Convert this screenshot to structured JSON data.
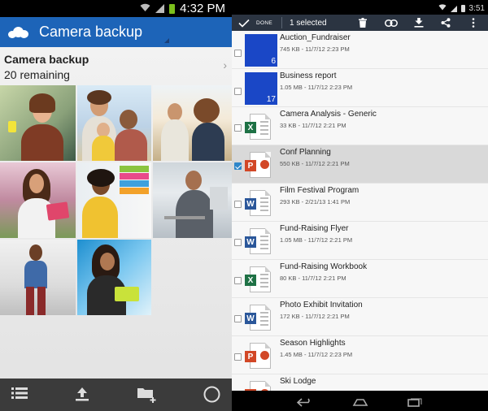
{
  "left": {
    "status": {
      "time": "4:32 PM",
      "icons": [
        "wifi-icon",
        "signal-icon",
        "battery-icon"
      ]
    },
    "appbar": {
      "title": "Camera backup",
      "icon": "cloud-icon"
    },
    "header": {
      "title": "Camera backup",
      "subtitle": "20 remaining",
      "chevron": "›"
    },
    "photos": [
      "woman-smiling-photo",
      "family-photo",
      "friends-outdoor-photo",
      "woman-with-tablet-photo",
      "woman-with-books-photo",
      "man-with-laptop-photo",
      "woman-walking-photo",
      "woman-on-couch-photo"
    ],
    "bottombar": {
      "icons": [
        "list-icon",
        "upload-icon",
        "add-folder-icon",
        "camera-circle-icon"
      ]
    }
  },
  "right": {
    "status": {
      "time": "3:51"
    },
    "actionbar": {
      "done_label": "DONE",
      "selected_label": "1 selected",
      "icons": [
        "delete-icon",
        "link-icon",
        "download-icon",
        "share-icon",
        "overflow-menu-icon"
      ]
    },
    "files": [
      {
        "name": "Auction_Fundraiser",
        "meta": "745 KB - 11/7/12 2:23 PM",
        "type": "folder",
        "count": "6",
        "selected": false
      },
      {
        "name": "Business report",
        "meta": "1.05 MB - 11/7/12 2:23 PM",
        "type": "folder",
        "count": "17",
        "selected": false
      },
      {
        "name": "Camera Analysis - Generic",
        "meta": "33 KB - 11/7/12 2:21 PM",
        "type": "excel",
        "selected": false
      },
      {
        "name": "Conf Planning",
        "meta": "550 KB - 11/7/12 2:21 PM",
        "type": "powerpoint",
        "selected": true
      },
      {
        "name": "Film Festival Program",
        "meta": "293 KB - 2/21/13 1:41 PM",
        "type": "word",
        "selected": false
      },
      {
        "name": "Fund-Raising Flyer",
        "meta": "1.05 MB - 11/7/12 2:21 PM",
        "type": "word",
        "selected": false
      },
      {
        "name": "Fund-Raising Workbook",
        "meta": "80 KB - 11/7/12 2:21 PM",
        "type": "excel",
        "selected": false
      },
      {
        "name": "Photo Exhibit Invitation",
        "meta": "172 KB - 11/7/12 2:21 PM",
        "type": "word",
        "selected": false
      },
      {
        "name": "Season Highlights",
        "meta": "1.45 MB - 11/7/12 2:23 PM",
        "type": "powerpoint",
        "selected": false
      },
      {
        "name": "Ski Lodge",
        "meta": "",
        "type": "powerpoint",
        "selected": false
      }
    ],
    "navbar": {
      "icons": [
        "back-icon",
        "home-icon",
        "recents-icon"
      ]
    },
    "colors": {
      "excel": "#1e7145",
      "powerpoint": "#d24726",
      "word": "#2b579a",
      "folder": "#1a47c6",
      "selected_row": "#d9d9d9",
      "actionbar": "#2b3441"
    }
  }
}
